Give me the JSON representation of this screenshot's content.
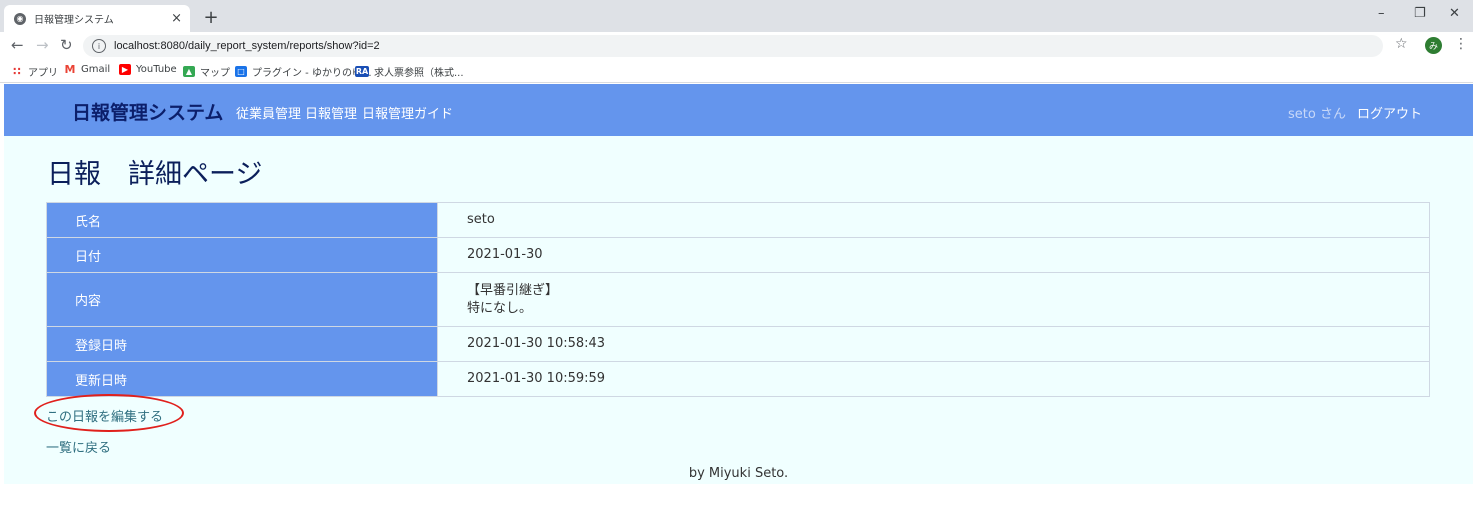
{
  "browser": {
    "tab_title": "日報管理システム",
    "tab_close": "×",
    "new_tab": "+",
    "url": "localhost:8080/daily_report_system/reports/show?id=2",
    "profile_initial": "み",
    "bookmarks": [
      {
        "label": "アプリ",
        "icon": "apps-grid-icon",
        "color": "#e53935"
      },
      {
        "label": "Gmail",
        "icon": "gmail-icon",
        "color": "#ea4335"
      },
      {
        "label": "YouTube",
        "icon": "youtube-icon",
        "color": "#ff0000"
      },
      {
        "label": "マップ",
        "icon": "maps-icon",
        "color": "#34a853"
      },
      {
        "label": "プラグイン - ゆかりのゆ...",
        "icon": "plugin-icon",
        "color": "#1a73e8"
      },
      {
        "label": "求人票参照（株式...",
        "icon": "job-icon",
        "color": "#1a4fb5"
      }
    ]
  },
  "header": {
    "brand": "日報管理システム",
    "nav": [
      "従業員管理",
      "日報管理",
      "日報管理ガイド"
    ],
    "user": "seto さん",
    "logout": "ログアウト"
  },
  "main": {
    "title": "日報　詳細ページ",
    "rows": [
      {
        "label": "氏名",
        "value": "seto"
      },
      {
        "label": "日付",
        "value": "2021-01-30"
      },
      {
        "label": "内容",
        "value_lines": [
          "【早番引継ぎ】",
          "特になし。"
        ]
      },
      {
        "label": "登録日時",
        "value": "2021-01-30 10:58:43"
      },
      {
        "label": "更新日時",
        "value": "2021-01-30 10:59:59"
      }
    ],
    "edit_link": "この日報を編集する",
    "back_link": "一覧に戻る"
  },
  "footer": {
    "text": "by Miyuki Seto."
  },
  "colors": {
    "header_bg": "#6495ed",
    "page_bg": "#f0ffff",
    "brand_text": "#0c1f6b",
    "link": "#2f6f80",
    "highlight_circle": "#e0201c"
  }
}
